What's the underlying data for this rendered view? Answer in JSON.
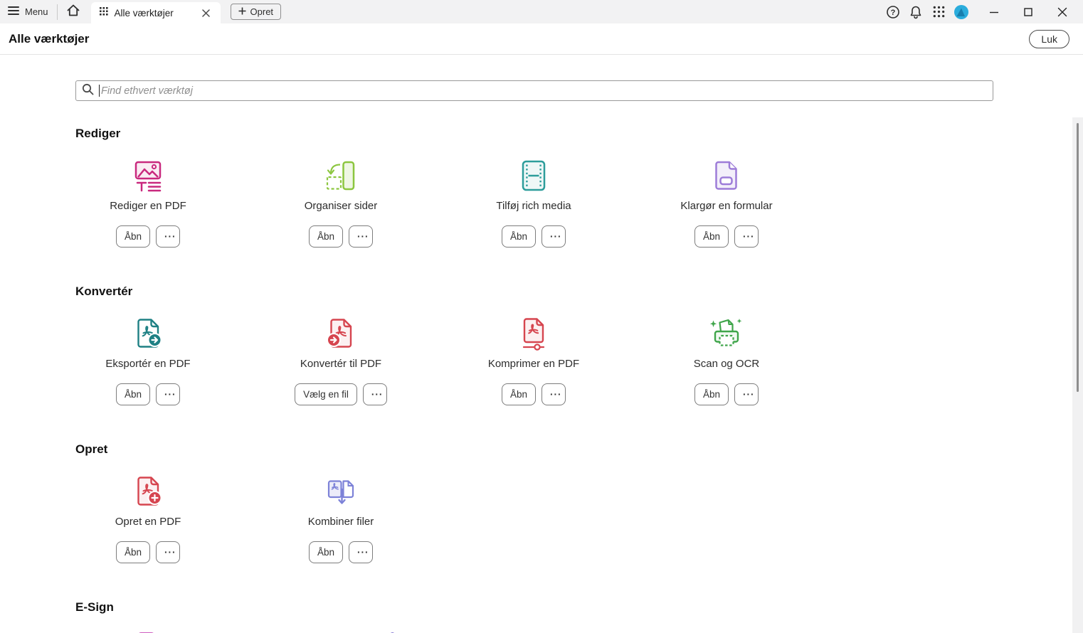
{
  "titlebar": {
    "menu_label": "Menu",
    "tab_label": "Alle værktøjer",
    "create_button_label": "Opret",
    "avatar_bg": "#2aacdc",
    "avatar_shape": "#187fae"
  },
  "header": {
    "title": "Alle værktøjer",
    "close_button_label": "Luk"
  },
  "search": {
    "placeholder": "Find ethvert værktøj"
  },
  "more_button_label": "···",
  "sections": [
    {
      "title": "Rediger",
      "tools": [
        {
          "label": "Rediger en PDF",
          "button": "Åbn",
          "icon": "edit-pdf",
          "color": "#c9297e"
        },
        {
          "label": "Organiser sider",
          "button": "Åbn",
          "icon": "organize-pages",
          "color": "#8cc63f"
        },
        {
          "label": "Tilføj rich media",
          "button": "Åbn",
          "icon": "rich-media",
          "color": "#2d9d9b"
        },
        {
          "label": "Klargør en formular",
          "button": "Åbn",
          "icon": "prepare-form",
          "color": "#9d7cd8"
        }
      ]
    },
    {
      "title": "Konvertér",
      "tools": [
        {
          "label": "Eksportér en PDF",
          "button": "Åbn",
          "icon": "export-pdf",
          "color": "#1e8084"
        },
        {
          "label": "Konvertér til PDF",
          "button": "Vælg en fil",
          "icon": "convert-pdf",
          "color": "#d6454f"
        },
        {
          "label": "Komprimer en PDF",
          "button": "Åbn",
          "icon": "compress-pdf",
          "color": "#d6454f"
        },
        {
          "label": "Scan og OCR",
          "button": "Åbn",
          "icon": "scan-ocr",
          "color": "#3fa54a"
        }
      ]
    },
    {
      "title": "Opret",
      "tools": [
        {
          "label": "Opret en PDF",
          "button": "Åbn",
          "icon": "create-pdf",
          "color": "#d6454f"
        },
        {
          "label": "Kombiner filer",
          "button": "Åbn",
          "icon": "combine-files",
          "color": "#7d82d8"
        }
      ]
    },
    {
      "title": "E-Sign",
      "tools": [],
      "partial_tool_colors": [
        "#cf5fc0",
        "#8a7fd6"
      ]
    }
  ]
}
